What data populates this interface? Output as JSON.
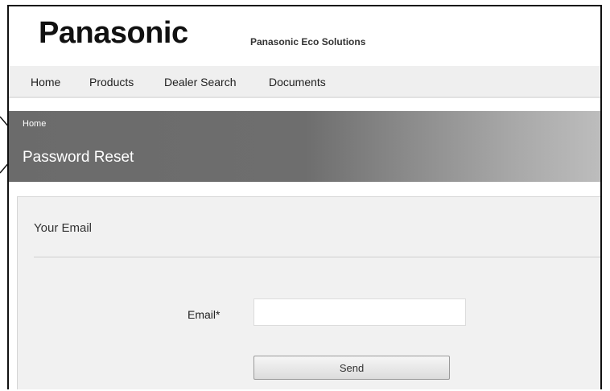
{
  "header": {
    "logo": "Panasonic",
    "tagline": "Panasonic Eco Solutions"
  },
  "nav": {
    "items": [
      {
        "label": "Home"
      },
      {
        "label": "Products"
      },
      {
        "label": "Dealer Search"
      },
      {
        "label": "Documents"
      }
    ]
  },
  "banner": {
    "breadcrumb": "Home",
    "title": "Password Reset"
  },
  "form": {
    "section_title": "Your Email",
    "email_label": "Email*",
    "email_value": "",
    "send_label": "Send"
  },
  "colors": {
    "banner_start": "#6b6b6b",
    "banner_end": "#bdbdbd",
    "panel_bg": "#f1f1f1",
    "nav_bg": "#efefef"
  }
}
